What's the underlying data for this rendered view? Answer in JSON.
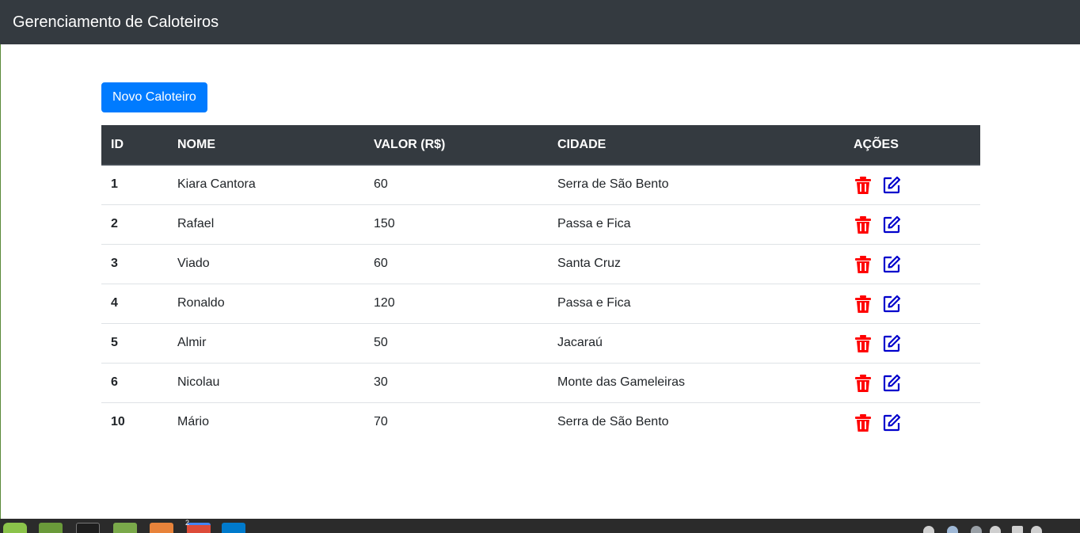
{
  "navbar": {
    "title": "Gerenciamento de Caloteiros"
  },
  "toolbar": {
    "new_button": "Novo Caloteiro"
  },
  "table": {
    "headers": {
      "id": "ID",
      "nome": "NOME",
      "valor": "VALOR (R$)",
      "cidade": "CIDADE",
      "acoes": "AÇÕES"
    },
    "rows": [
      {
        "id": "1",
        "nome": "Kiara Cantora",
        "valor": "60",
        "cidade": "Serra de São Bento"
      },
      {
        "id": "2",
        "nome": "Rafael",
        "valor": "150",
        "cidade": "Passa e Fica"
      },
      {
        "id": "3",
        "nome": "Viado",
        "valor": "60",
        "cidade": "Santa Cruz"
      },
      {
        "id": "4",
        "nome": "Ronaldo",
        "valor": "120",
        "cidade": "Passa e Fica"
      },
      {
        "id": "5",
        "nome": "Almir",
        "valor": "50",
        "cidade": "Jacaraú"
      },
      {
        "id": "6",
        "nome": "Nicolau",
        "valor": "30",
        "cidade": "Monte das Gameleiras"
      },
      {
        "id": "10",
        "nome": "Mário",
        "valor": "70",
        "cidade": "Serra de São Bento"
      }
    ],
    "row_actions": {
      "delete_icon": "trash-icon",
      "edit_icon": "edit-icon"
    }
  },
  "taskbar": {
    "apps": [
      "mint-menu-icon",
      "file-manager-icon",
      "terminal-icon",
      "files-icon",
      "app-icon",
      "chrome-icon",
      "vscode-icon"
    ],
    "chrome_badge": "2",
    "tray": [
      "network-icon",
      "shield-icon",
      "volume-icon",
      "wifi-icon",
      "battery-icon",
      "power-icon"
    ]
  },
  "colors": {
    "navbar": "#343a40",
    "primary": "#007bff",
    "delete": "#ff0000",
    "edit": "#0000cc",
    "row_border": "#dee2e6"
  }
}
